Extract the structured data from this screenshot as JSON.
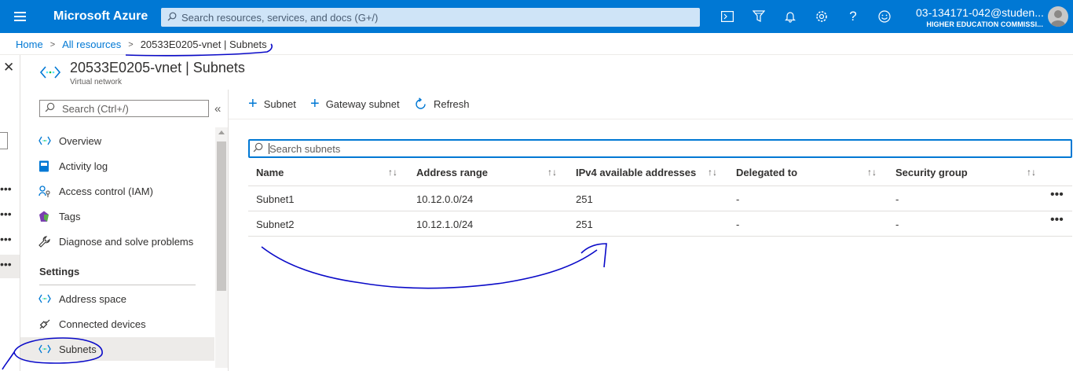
{
  "topbar": {
    "brand": "Microsoft Azure",
    "search_placeholder": "Search resources, services, and docs (G+/)",
    "icons": [
      "cloud-shell-icon",
      "directory-filter-icon",
      "notifications-icon",
      "settings-icon",
      "help-icon",
      "feedback-icon"
    ],
    "account_name": "03-134171-042@studen...",
    "account_org": "HIGHER EDUCATION COMMISSI..."
  },
  "breadcrumb": {
    "home": "Home",
    "all_resources": "All resources",
    "current": "20533E0205-vnet | Subnets",
    "separator": ">"
  },
  "resource": {
    "title": "20533E0205-vnet | Subnets",
    "subtitle": "Virtual network"
  },
  "menu": {
    "search_placeholder": "Search (Ctrl+/)",
    "items": [
      {
        "label": "Overview",
        "icon": "vnet-icon"
      },
      {
        "label": "Activity log",
        "icon": "activity-log-icon"
      },
      {
        "label": "Access control (IAM)",
        "icon": "iam-icon"
      },
      {
        "label": "Tags",
        "icon": "tag-icon"
      },
      {
        "label": "Diagnose and solve problems",
        "icon": "wrench-icon"
      }
    ],
    "section": "Settings",
    "settings_items": [
      {
        "label": "Address space",
        "icon": "vnet-icon"
      },
      {
        "label": "Connected devices",
        "icon": "plug-icon"
      },
      {
        "label": "Subnets",
        "icon": "vnet-icon",
        "selected": true
      }
    ]
  },
  "commands": {
    "subnet": "Subnet",
    "gateway_subnet": "Gateway subnet",
    "refresh": "Refresh"
  },
  "grid": {
    "search_placeholder": "Search subnets",
    "columns": [
      "Name",
      "Address range",
      "IPv4 available addresses",
      "Delegated to",
      "Security group"
    ],
    "rows": [
      {
        "name": "Subnet1",
        "address": "10.12.0.0/24",
        "available": "251",
        "delegated": "-",
        "nsg": "-"
      },
      {
        "name": "Subnet2",
        "address": "10.12.1.0/24",
        "available": "251",
        "delegated": "-",
        "nsg": "-"
      }
    ]
  },
  "colors": {
    "accent": "#0078d4",
    "annotation_ink": "#0a0ac8"
  }
}
